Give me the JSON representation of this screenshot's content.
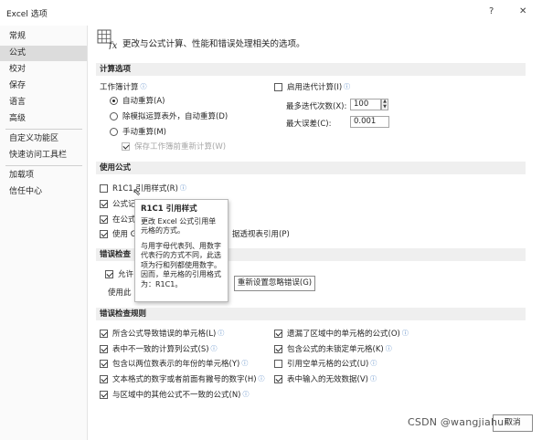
{
  "window": {
    "title": "Excel 选项",
    "help_glyph": "?",
    "close_glyph": "✕"
  },
  "sidebar": {
    "items": [
      {
        "label": "常规"
      },
      {
        "label": "公式",
        "selected": true
      },
      {
        "label": "校对"
      },
      {
        "label": "保存"
      },
      {
        "label": "语言"
      },
      {
        "label": "高级"
      },
      {
        "label": "自定义功能区"
      },
      {
        "label": "快速访问工具栏"
      },
      {
        "label": "加载项"
      },
      {
        "label": "信任中心"
      }
    ]
  },
  "header": {
    "icon": "formula-options-icon",
    "text": "更改与公式计算、性能和错误处理相关的选项。"
  },
  "calc": {
    "section_title": "计算选项",
    "workbook_calc_label": "工作簿计算",
    "auto": "自动重算(A)",
    "auto_except_tables": "除模拟运算表外，自动重算(D)",
    "manual": "手动重算(M)",
    "recalc_before_save": "保存工作簿前重新计算(W)",
    "iterative": "启用迭代计算(I)",
    "max_iterations_label": "最多迭代次数(X):",
    "max_iterations_value": "100",
    "max_change_label": "最大误差(C):",
    "max_change_value": "0.001"
  },
  "formulas": {
    "section_title": "使用公式",
    "r1c1": "R1C1 引用样式(R)",
    "autocomplete": "公式记",
    "table_names": "在公式",
    "getpivotdata": "使用 G",
    "getpivotdata_tail": "据透视表引用(P)"
  },
  "tooltip": {
    "title": "R1C1 引用样式",
    "line1": "更改 Excel 公式引用单元格的方式。",
    "line2": "与用字母代表列、用数字代表行的方式不同，此选项为行和列都使用数字。因而，单元格的引用格式为：R1C1。"
  },
  "error_check": {
    "section_title": "错误检查",
    "enable_background": "允许",
    "indicator_color": "使用此",
    "reset_button": "重新设置忽略错误(G)"
  },
  "rules": {
    "section_title": "错误检查规则",
    "left": [
      {
        "label": "所含公式导致错误的单元格(L)",
        "checked": true
      },
      {
        "label": "表中不一致的计算列公式(S)",
        "checked": true
      },
      {
        "label": "包含以两位数表示的年份的单元格(Y)",
        "checked": true
      },
      {
        "label": "文本格式的数字或者前面有撇号的数字(H)",
        "checked": true
      },
      {
        "label": "与区域中的其他公式不一致的公式(N)",
        "checked": true
      }
    ],
    "right": [
      {
        "label": "遗漏了区域中的单元格的公式(O)",
        "checked": true
      },
      {
        "label": "包含公式的未锁定单元格(K)",
        "checked": true
      },
      {
        "label": "引用空单元格的公式(U)",
        "checked": false
      },
      {
        "label": "表中输入的无效数据(V)",
        "checked": true
      }
    ]
  },
  "footer": {
    "watermark": "CSDN @wangjiahui",
    "cancel_label": "取消"
  }
}
